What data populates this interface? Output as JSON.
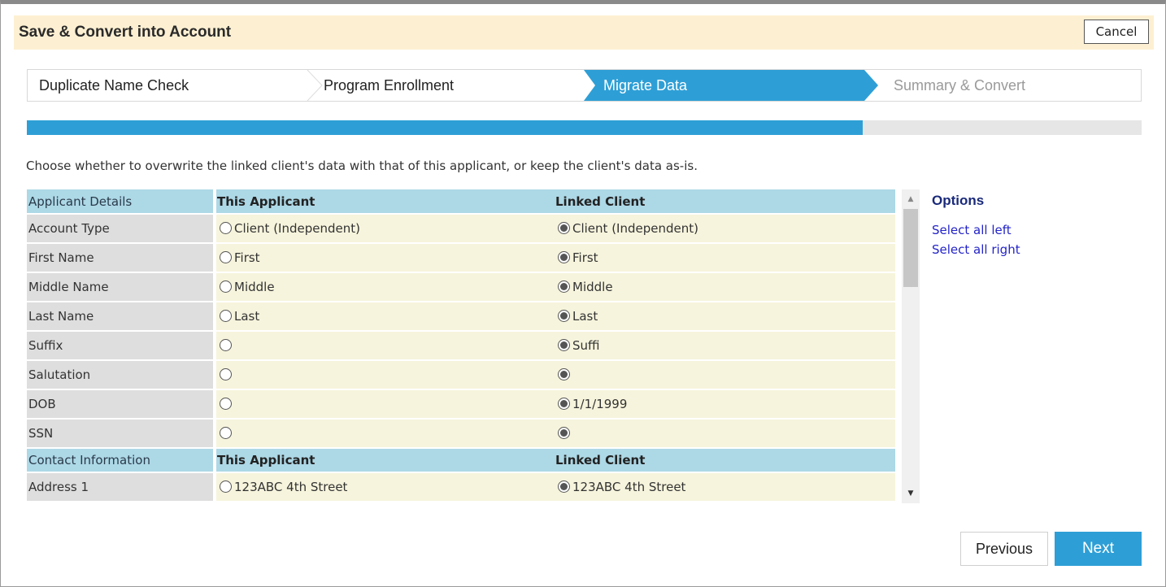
{
  "header": {
    "title": "Save & Convert into Account",
    "cancel_label": "Cancel"
  },
  "steps": [
    {
      "label": "Duplicate Name Check",
      "state": "done"
    },
    {
      "label": "Program Enrollment",
      "state": "done"
    },
    {
      "label": "Migrate Data",
      "state": "active"
    },
    {
      "label": "Summary & Convert",
      "state": "pending"
    }
  ],
  "progress": {
    "percent": 75
  },
  "instructions": "Choose whether to overwrite the linked client's data with that of this applicant, or keep the client's data as-is.",
  "table": {
    "sections": [
      {
        "title": "Applicant Details",
        "col_applicant": "This Applicant",
        "col_linked": "Linked Client",
        "rows": [
          {
            "field": "Account Type",
            "applicant": "Client (Independent)",
            "linked": "Client (Independent)",
            "selected": "linked"
          },
          {
            "field": "First Name",
            "applicant": "First",
            "linked": "First",
            "selected": "linked"
          },
          {
            "field": "Middle Name",
            "applicant": "Middle",
            "linked": "Middle",
            "selected": "linked"
          },
          {
            "field": "Last Name",
            "applicant": "Last",
            "linked": "Last",
            "selected": "linked"
          },
          {
            "field": "Suffix",
            "applicant": "",
            "linked": "Suffi",
            "selected": "linked"
          },
          {
            "field": "Salutation",
            "applicant": "",
            "linked": "",
            "selected": "linked"
          },
          {
            "field": "DOB",
            "applicant": "",
            "linked": "1/1/1999",
            "selected": "linked"
          },
          {
            "field": "SSN",
            "applicant": "",
            "linked": "",
            "selected": "linked"
          }
        ]
      },
      {
        "title": "Contact Information",
        "col_applicant": "This Applicant",
        "col_linked": "Linked Client",
        "rows": [
          {
            "field": "Address 1",
            "applicant": "123ABC 4th Street",
            "linked": "123ABC 4th Street",
            "selected": "linked"
          }
        ]
      }
    ]
  },
  "options": {
    "title": "Options",
    "select_all_left": "Select all left",
    "select_all_right": "Select all right"
  },
  "footer": {
    "previous_label": "Previous",
    "next_label": "Next"
  },
  "colors": {
    "accent": "#2e9fd6",
    "header_bg": "#fdf0d2",
    "section_bg": "#add8e6",
    "value_bg": "#f6f4dc"
  }
}
